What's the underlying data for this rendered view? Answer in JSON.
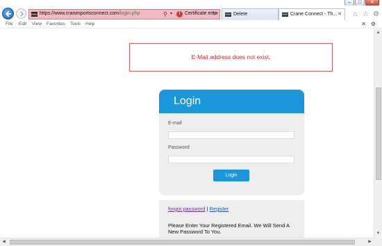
{
  "browser": {
    "url_host": "https://www.cranesportsconnect.com",
    "url_path": "/login.php",
    "cert_error": "Certificate error",
    "favicon_text": "CSC",
    "tabs": [
      {
        "label": "Delete",
        "active": false
      },
      {
        "label": "Crane Connect - Th...",
        "active": true
      }
    ],
    "menu": [
      "File",
      "Edit",
      "View",
      "Favorites",
      "Tools",
      "Help"
    ]
  },
  "page": {
    "error_message": "E-Mail address does not exist.",
    "login": {
      "title": "Login",
      "email_label": "E-mail",
      "email_value": "",
      "password_label": "Password",
      "password_value": "",
      "submit_label": "Login"
    },
    "forgot": {
      "forgot_link": "forgot password",
      "separator": " | ",
      "register_link": "Register",
      "message": "Please Enter Your Registered Email. We Will Send A New Password To You."
    }
  },
  "colors": {
    "accent": "#1a97db",
    "error": "#e02525",
    "address_error_bg": "#f4b9c2"
  }
}
